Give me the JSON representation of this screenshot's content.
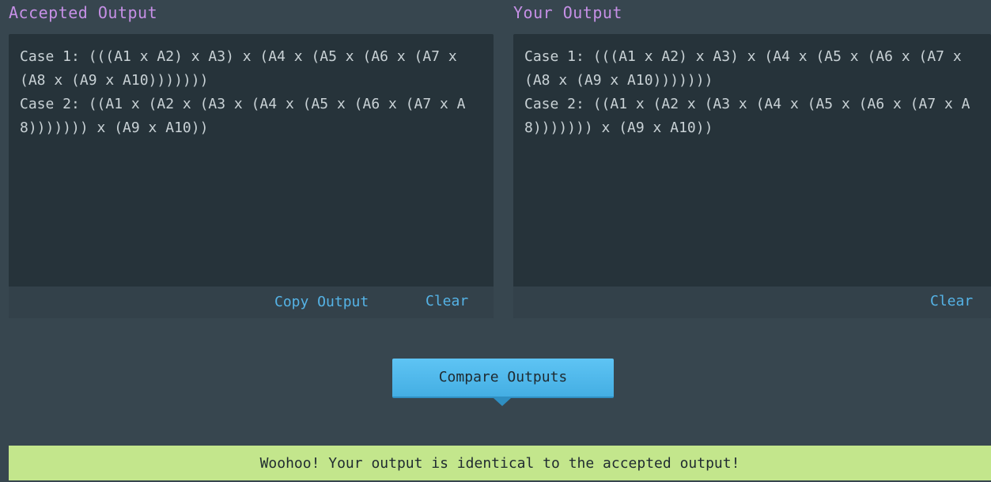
{
  "accepted": {
    "title": "Accepted Output",
    "content": "Case 1: (((A1 x A2) x A3) x (A4 x (A5 x (A6 x (A7 x (A8 x (A9 x A10)))))))\nCase 2: ((A1 x (A2 x (A3 x (A4 x (A5 x (A6 x (A7 x A8))))))) x (A9 x A10))",
    "copy_label": "Copy Output",
    "clear_label": "Clear"
  },
  "yours": {
    "title": "Your Output",
    "content": "Case 1: (((A1 x A2) x A3) x (A4 x (A5 x (A6 x (A7 x (A8 x (A9 x A10)))))))\nCase 2: ((A1 x (A2 x (A3 x (A4 x (A5 x (A6 x (A7 x A8))))))) x (A9 x A10))",
    "clear_label": "Clear"
  },
  "compare_button": {
    "label": "Compare Outputs"
  },
  "result": {
    "message": "Woohoo! Your output is identical to the accepted output!"
  },
  "colors": {
    "background": "#37464f",
    "panel": "#26333a",
    "title": "#c690e6",
    "link": "#55b3e6",
    "button": "#5ec4f4",
    "success": "#c3e68c"
  }
}
